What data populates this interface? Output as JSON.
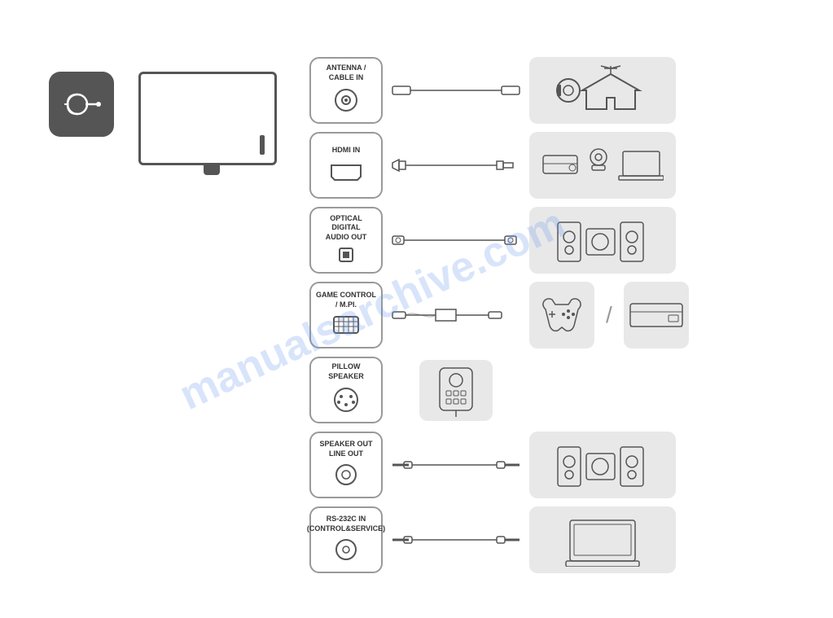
{
  "watermark": "manualsarchive.com",
  "ports": [
    {
      "id": "antenna",
      "label_line1": "ANTENNA /",
      "label_line2": "CABLE IN",
      "cable_type": "coax",
      "device_type": "antenna_home"
    },
    {
      "id": "hdmi",
      "label_line1": "HDMI IN",
      "label_line2": "",
      "cable_type": "hdmi",
      "device_type": "bluray_camera_laptop"
    },
    {
      "id": "optical",
      "label_line1": "OPTICAL",
      "label_line2": "DIGITAL",
      "label_line3": "AUDIO OUT",
      "cable_type": "optical",
      "device_type": "speakers"
    },
    {
      "id": "game",
      "label_line1": "GAME CONTROL",
      "label_line2": "/ M.PI.",
      "cable_type": "rj45_style",
      "device_type": "gamepad_bluray"
    },
    {
      "id": "pillow",
      "label_line1": "PILLOW",
      "label_line2": "SPEAKER",
      "cable_type": "pillow_speaker",
      "device_type": "pillow_device"
    },
    {
      "id": "speaker_out",
      "label_line1": "SPEAKER OUT",
      "label_line2": "LINE OUT",
      "cable_type": "aux",
      "device_type": "speakers2"
    },
    {
      "id": "rs232c",
      "label_line1": "RS-232C IN",
      "label_line2": "(CONTROL&SERVICE)",
      "cable_type": "rs232",
      "device_type": "laptop2"
    }
  ]
}
